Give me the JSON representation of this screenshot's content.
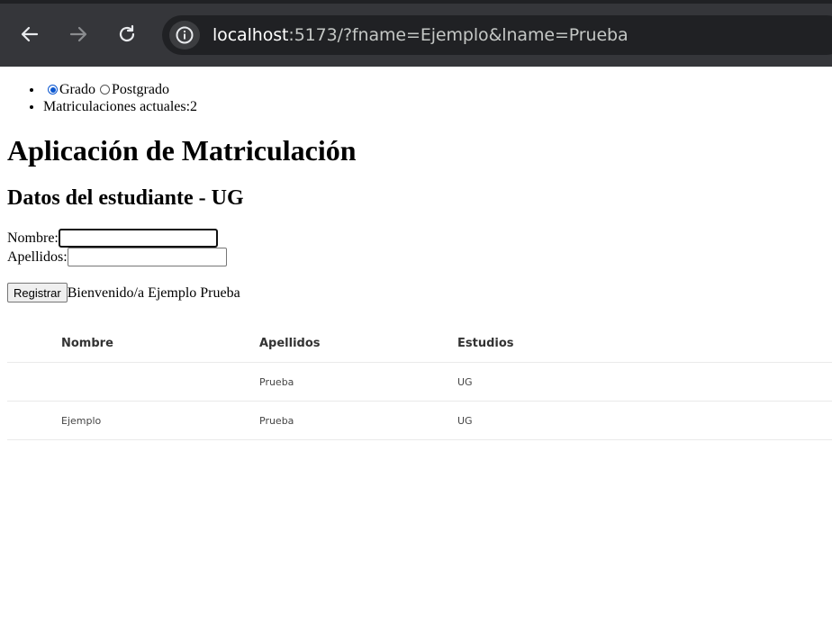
{
  "browser": {
    "url_host": "localhost",
    "url_rest": ":5173/?fname=Ejemplo&lname=Prueba",
    "back_icon": "arrow-left-icon",
    "forward_icon": "arrow-right-icon",
    "reload_icon": "reload-icon",
    "site_info_icon": "info-icon"
  },
  "options": {
    "grado_label": "Grado",
    "postgrado_label": "Postgrado",
    "selected": "Grado",
    "matriculaciones_label": "Matriculaciones actuales:",
    "matriculaciones_count": "2"
  },
  "page": {
    "title": "Aplicación de Matriculación",
    "subtitle": "Datos del estudiante - UG"
  },
  "form": {
    "nombre_label": "Nombre:",
    "nombre_value": "",
    "apellidos_label": "Apellidos:",
    "apellidos_value": "",
    "submit_label": "Registrar",
    "welcome_message": "Bienvenido/a Ejemplo Prueba"
  },
  "table": {
    "headers": [
      "Nombre",
      "Apellidos",
      "Estudios"
    ],
    "rows": [
      [
        "",
        "Prueba",
        "UG"
      ],
      [
        "Ejemplo",
        "Prueba",
        "UG"
      ]
    ]
  }
}
